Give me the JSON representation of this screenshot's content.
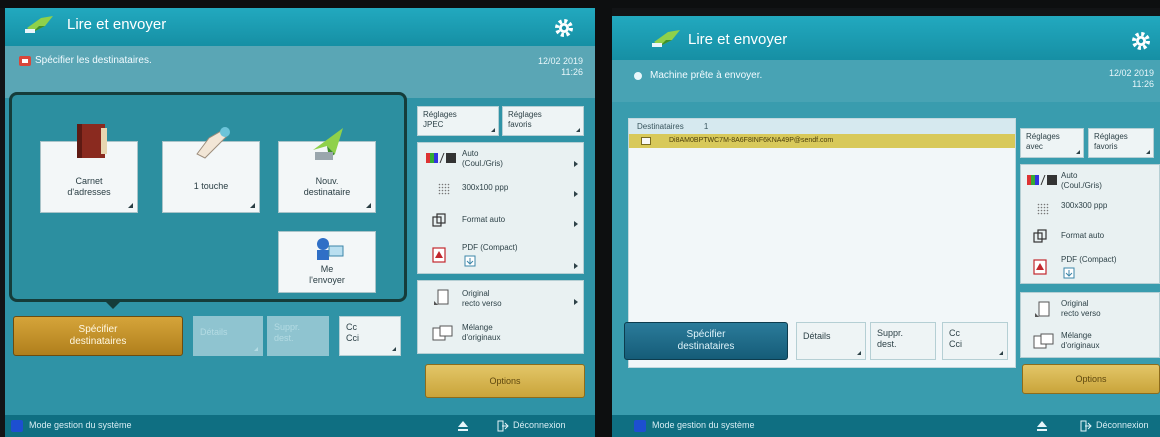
{
  "colors": {
    "header": "#1c9cb2",
    "accent_gold": "#c89c32",
    "accent_blue": "#1e6d8c",
    "selected_row": "#d8c95a",
    "sys_icon": "#1d4fd0"
  },
  "left_screen": {
    "app_title": "Lire et envoyer",
    "status_message": "Spécifier les destinataires.",
    "date": "12/02 2019",
    "time": "11:26",
    "tiles": [
      {
        "label_line1": "Carnet",
        "label_line2": "d'adresses",
        "icon": "address-book-icon"
      },
      {
        "label_line1": "1 touche",
        "label_line2": "",
        "icon": "one-touch-hand-icon"
      },
      {
        "label_line1": "Nouv.",
        "label_line2": "destinataire",
        "icon": "new-destination-icon"
      },
      {
        "label_line1": "Me",
        "label_line2": "l'envoyer",
        "icon": "send-to-myself-icon"
      }
    ],
    "settings_buttons": {
      "jpeg_line1": "Réglages",
      "jpeg_line2": "JPEC",
      "fav_line1": "Réglages",
      "fav_line2": "favoris"
    },
    "scan_settings": {
      "color_line1": "Auto",
      "color_line2": "(Coul./Gris)",
      "resolution": "300x100 ppp",
      "format": "Format auto",
      "file_type": "PDF (Compact)"
    },
    "original_settings": {
      "original_line1": "Original",
      "original_line2": "recto verso",
      "mixed_line1": "Mélange",
      "mixed_line2": "d'originaux"
    },
    "bottom_buttons": {
      "specify_line1": "Spécifier",
      "specify_line2": "destinataires",
      "details": "Détails",
      "delete_line1": "Suppr.",
      "delete_line2": "dest.",
      "cc_line1": "Cc",
      "cc_line2": "Cci"
    },
    "options": "Options",
    "footer": {
      "system_mode": "Mode gestion du système",
      "logout": "Déconnexion"
    }
  },
  "right_screen": {
    "app_title": "Lire et envoyer",
    "status_message": "Machine prête à envoyer.",
    "date": "12/02 2019",
    "time": "11:26",
    "destinations_label": "Destinataires",
    "destinations_count": "1",
    "destination_entry": "Di8AM0BPTWC7M-8A6F8INF6KNA49P@sendf.com",
    "settings_buttons": {
      "jpeg_line1": "Réglages",
      "jpeg_line2": "avec",
      "fav_line1": "Réglages",
      "fav_line2": "favoris"
    },
    "scan_settings": {
      "color_line1": "Auto",
      "color_line2": "(Coul./Gris)",
      "resolution": "300x300 ppp",
      "format": "Format auto",
      "file_type": "PDF (Compact)"
    },
    "original_settings": {
      "original_line1": "Original",
      "original_line2": "recto verso",
      "mixed_line1": "Mélange",
      "mixed_line2": "d'originaux"
    },
    "bottom_buttons": {
      "specify_line1": "Spécifier",
      "specify_line2": "destinataires",
      "details": "Détails",
      "delete_line1": "Suppr.",
      "delete_line2": "dest.",
      "cc_line1": "Cc",
      "cc_line2": "Cci"
    },
    "options": "Options",
    "footer": {
      "system_mode": "Mode gestion du système",
      "logout": "Déconnexion"
    }
  }
}
